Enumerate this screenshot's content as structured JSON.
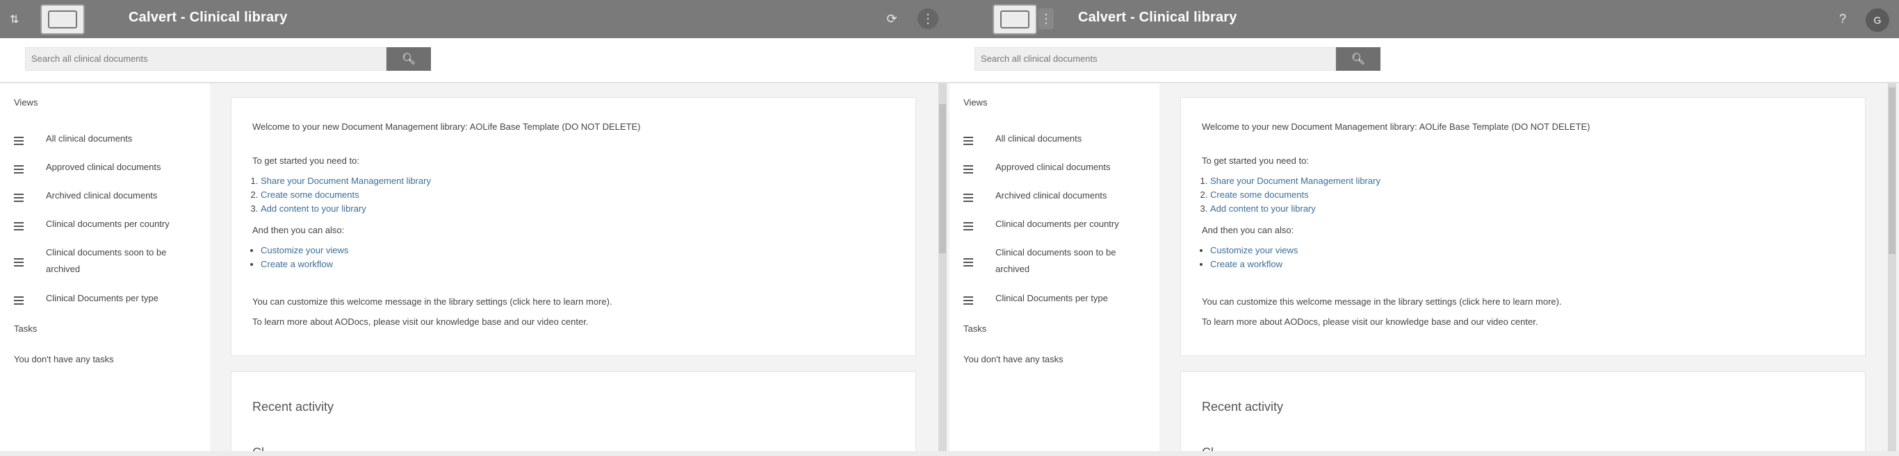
{
  "app": {
    "title": "Calvert - Clinical library",
    "user_initial": "G"
  },
  "search": {
    "placeholder": "Search all clinical documents"
  },
  "sidebar": {
    "views_heading": "Views",
    "items": [
      {
        "label": "All clinical documents"
      },
      {
        "label": "Approved clinical documents"
      },
      {
        "label": "Archived clinical documents"
      },
      {
        "label": "Clinical documents per country"
      },
      {
        "label": "Clinical documents soon to be archived"
      },
      {
        "label": "Clinical Documents per type"
      }
    ],
    "tasks_heading": "Tasks",
    "no_tasks": "You don't have any tasks"
  },
  "welcome": {
    "intro": "Welcome to your new Document Management library: AOLife Base Template (DO NOT DELETE)",
    "get_started": "To get started you need to:",
    "steps": [
      "Share your Document Management library",
      "Create some documents",
      "Add content to your library"
    ],
    "also": "And then you can also:",
    "also_items": [
      "Customize your views",
      "Create a workflow"
    ],
    "customize_note": "You can customize this welcome message in the library settings (click here to learn more).",
    "learn_more": "To learn more about AODocs, please visit our knowledge base and our video center."
  },
  "recent": {
    "title": "Recent activity",
    "partial": "Cl"
  },
  "colors": {
    "topbar": "#7a7a7a",
    "search_button": "#6f6f6f",
    "link": "#3a6e9a"
  },
  "icons": {
    "search": "search-icon",
    "menu": "menu-lines-icon",
    "refresh": "refresh-icon",
    "apps": "apps-icon",
    "expand": "expand-icon",
    "help": "help-icon"
  }
}
